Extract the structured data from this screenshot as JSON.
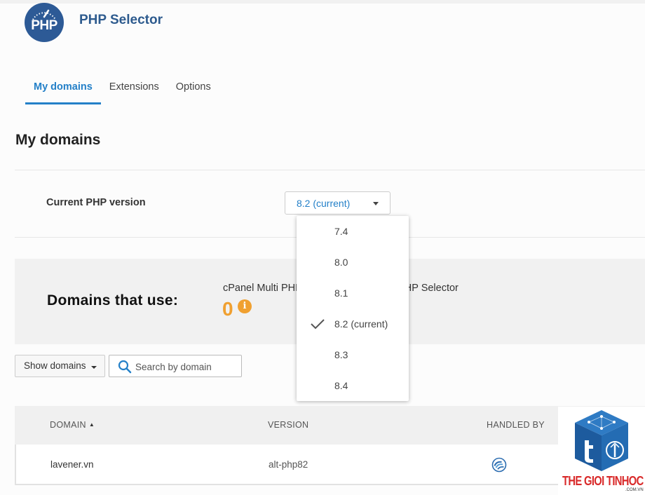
{
  "app": {
    "logo_text": "PHP",
    "title": "PHP Selector"
  },
  "tabs": [
    {
      "label": "My domains",
      "active": true
    },
    {
      "label": "Extensions",
      "active": false
    },
    {
      "label": "Options",
      "active": false
    }
  ],
  "section": {
    "title": "My domains"
  },
  "php_version": {
    "label": "Current PHP version",
    "selected": "8.2 (current)",
    "options": [
      "7.4",
      "8.0",
      "8.1",
      "8.2 (current)",
      "8.3",
      "8.4"
    ],
    "checked_index": 3
  },
  "summary": {
    "title": "Domains that use:",
    "subtitle": "cPanel Multi PHP",
    "subtitle_tail": "x PHP Selector",
    "count": "0",
    "info_icon": "i"
  },
  "toolbar": {
    "show_domains_label": "Show domains",
    "search_placeholder": "Search by domain"
  },
  "table": {
    "columns": [
      "DOMAIN",
      "VERSION",
      "HANDLED BY"
    ],
    "sort_indicator": "▲",
    "rows": [
      {
        "domain": "lavener.vn",
        "version": "alt-php82",
        "handled_by_icon": "cloudlinux-icon"
      }
    ]
  },
  "watermark": {
    "text": "THE GIOI TINHOC",
    "sub": ".COM.VN"
  },
  "colors": {
    "accent": "#2480c8",
    "brand": "#2e5b8e",
    "warning": "#f0a030",
    "watermark_red": "#d92a2a"
  }
}
